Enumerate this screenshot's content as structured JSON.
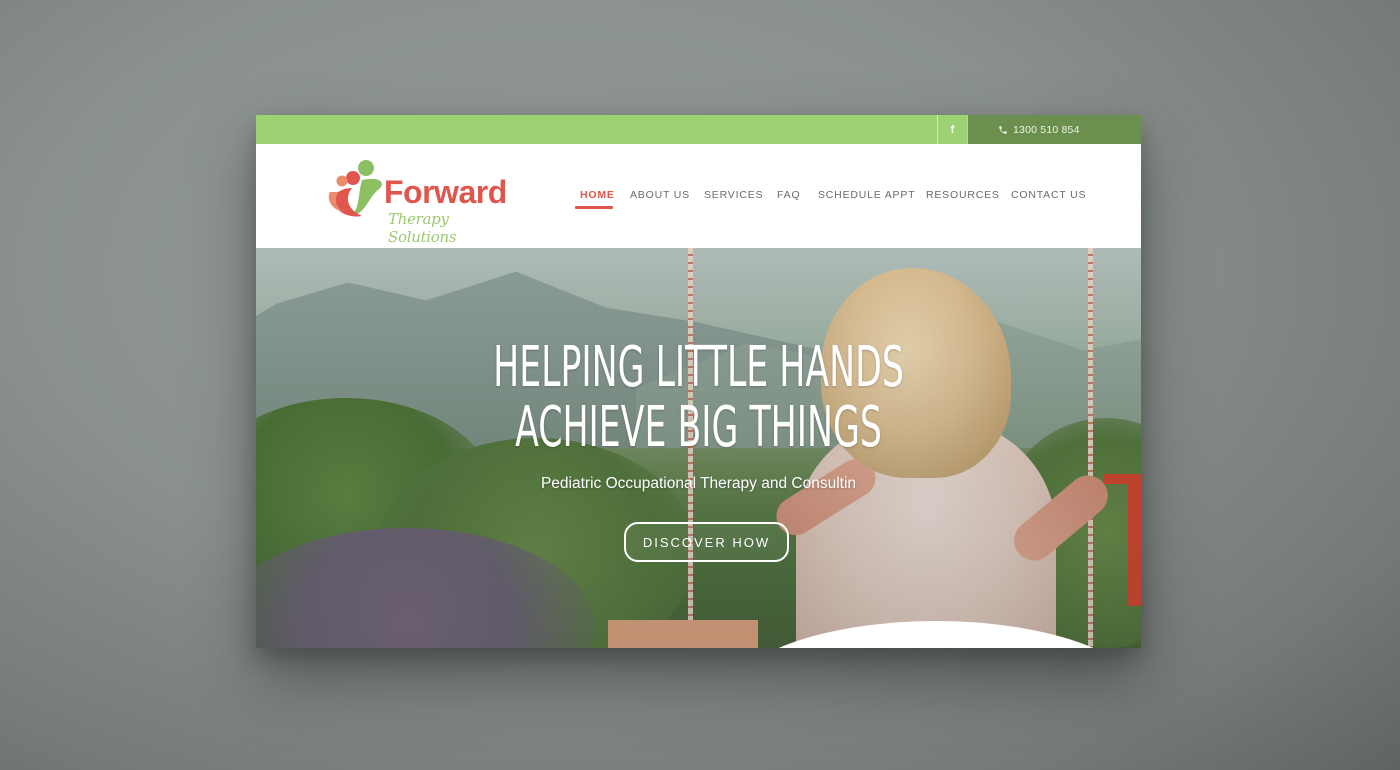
{
  "topbar": {
    "facebook_icon": "facebook-icon",
    "facebook_glyph": "f",
    "phone_icon": "phone-icon",
    "phone": "1300 510 854"
  },
  "logo": {
    "word": "Forward",
    "tagline": "Therapy Solutions"
  },
  "nav": {
    "items": [
      {
        "label": "HOME",
        "active": true
      },
      {
        "label": "ABOUT US"
      },
      {
        "label": "SERVICES"
      },
      {
        "label": "FAQ"
      },
      {
        "label": "SCHEDULE APPT"
      },
      {
        "label": "RESOURCES"
      },
      {
        "label": "CONTACT US"
      }
    ]
  },
  "hero": {
    "title_line1": "HELPING LITTLE HANDS",
    "title_line2": "ACHIEVE BIG THINGS",
    "subtitle": "Pediatric Occupational Therapy and Consultin",
    "button": "DISCOVER HOW"
  },
  "colors": {
    "topbar_green": "#9dd272",
    "phone_box_green": "#6b8f4e",
    "accent_coral": "#e0564c",
    "logo_green": "#9cc96f"
  }
}
